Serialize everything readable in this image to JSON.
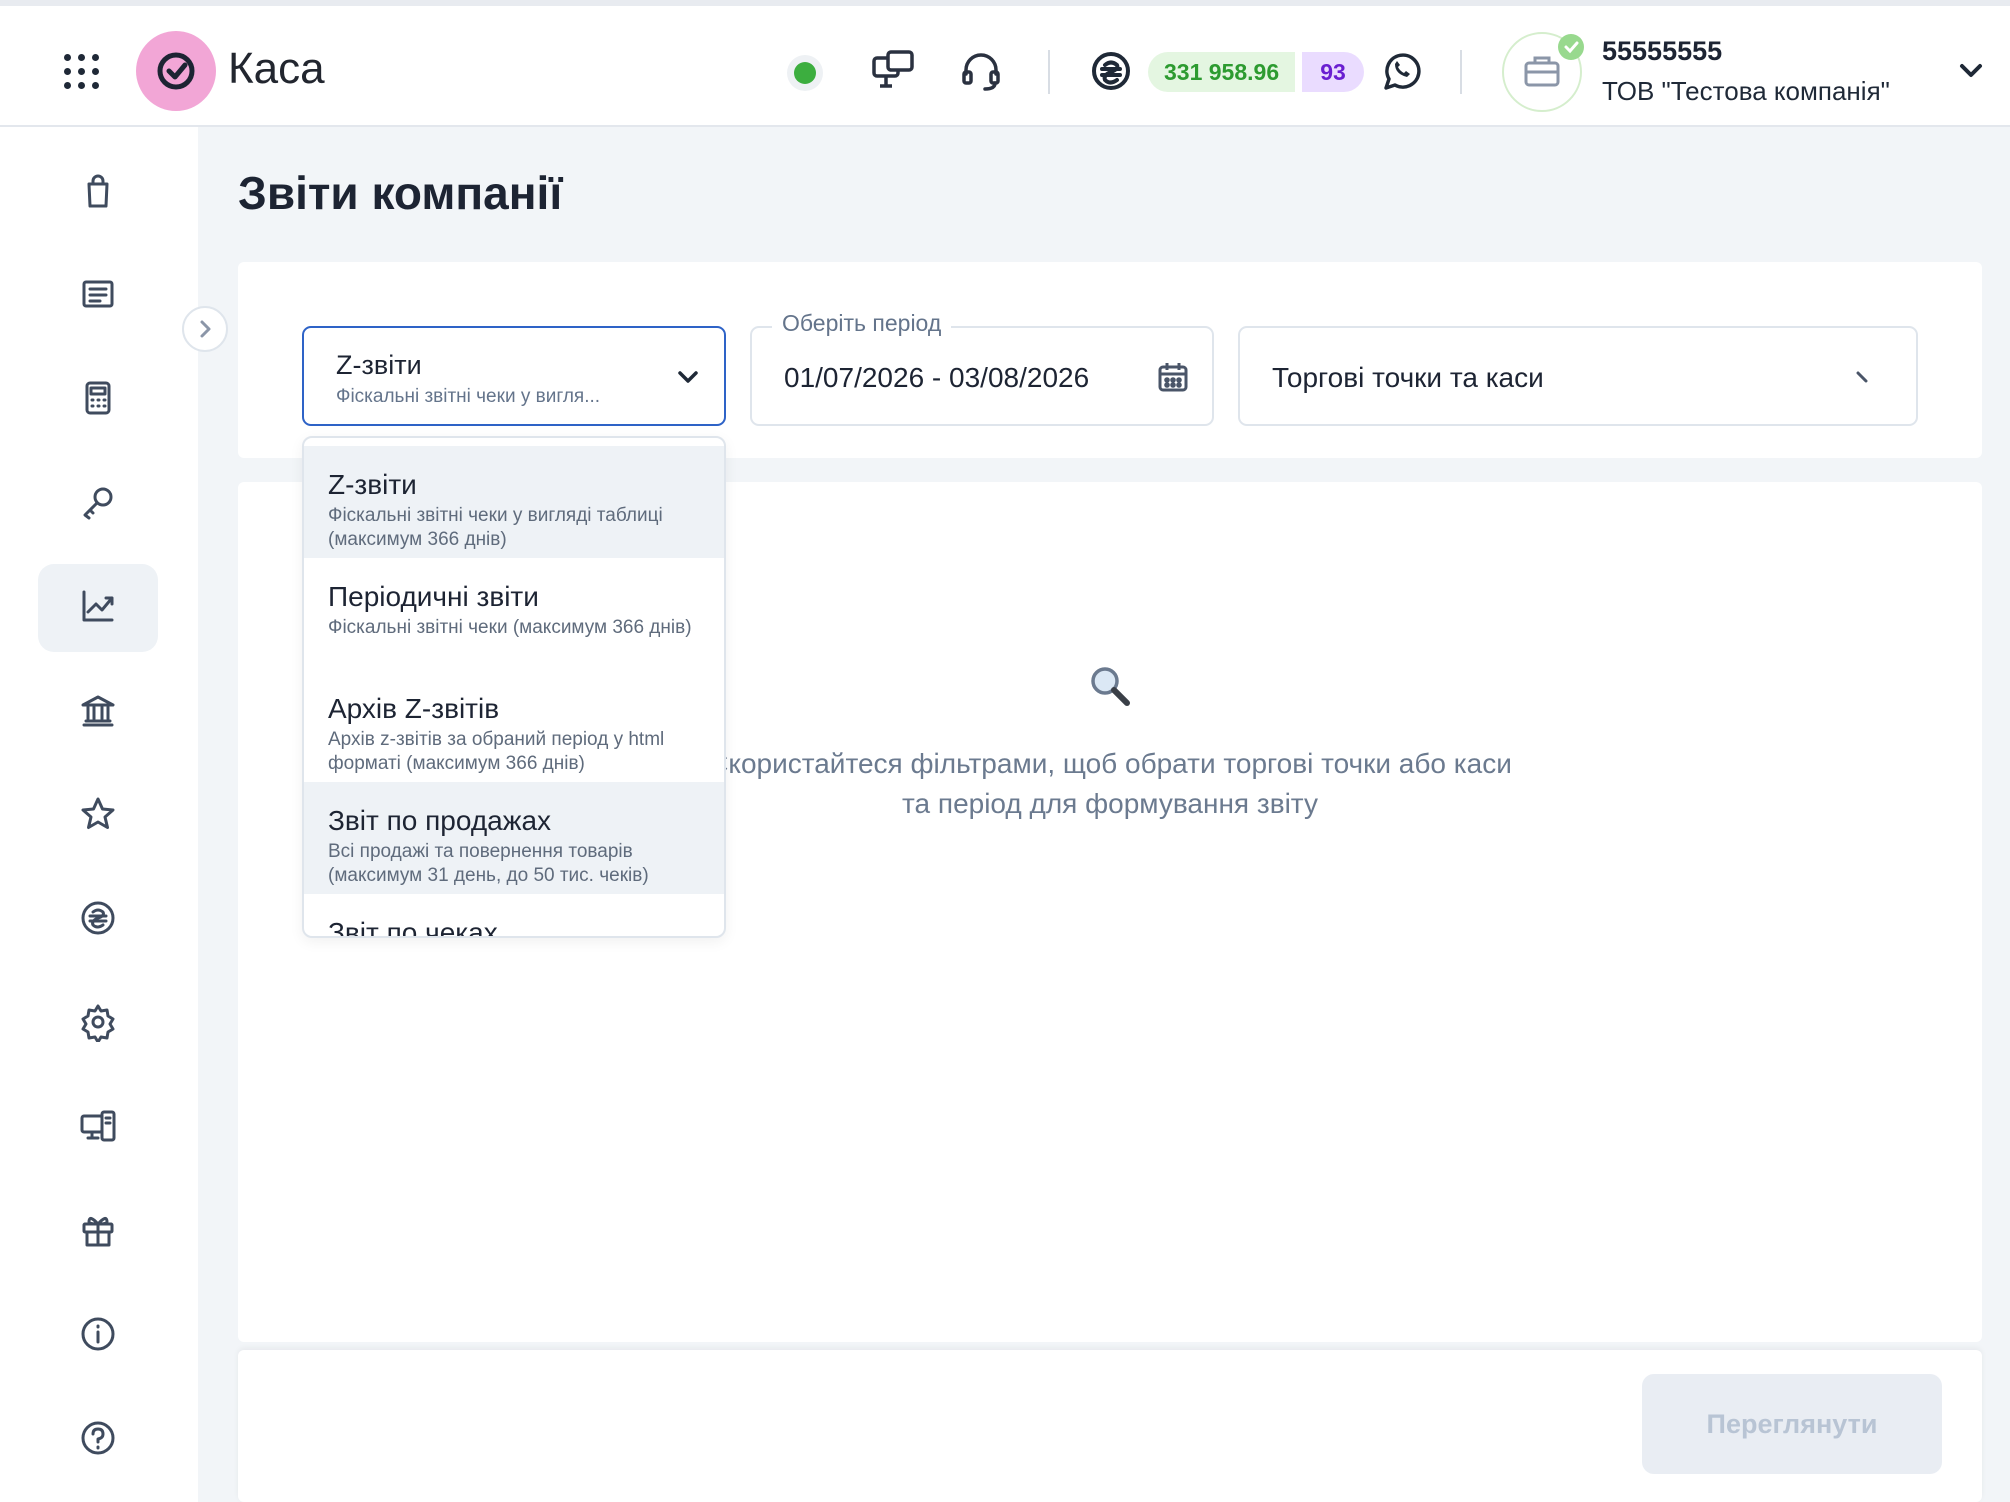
{
  "app": {
    "name": "Каса",
    "balance": "331 958.96",
    "count": "93",
    "company_id": "55555555",
    "company_name": "ТОВ \"Тестова компанія\""
  },
  "sidebar": {
    "items": [
      {
        "icon": "shopping-bag-icon"
      },
      {
        "icon": "receipt-icon"
      },
      {
        "icon": "calculator-icon"
      },
      {
        "icon": "key-icon"
      },
      {
        "icon": "chart-icon",
        "active": true
      },
      {
        "icon": "bank-icon"
      },
      {
        "icon": "star-icon"
      },
      {
        "icon": "hryvnia-icon"
      },
      {
        "icon": "settings-icon"
      },
      {
        "icon": "devices-icon"
      },
      {
        "icon": "gift-icon"
      },
      {
        "icon": "info-icon"
      },
      {
        "icon": "help-icon"
      }
    ]
  },
  "page": {
    "title": "Звіти компанії"
  },
  "filters": {
    "report": {
      "title": "Z-звіти",
      "subtitle": "Фіскальні звітні чеки у вигля..."
    },
    "period": {
      "label": "Оберіть період",
      "value": "01/07/2026 - 03/08/2026"
    },
    "points": {
      "value": "Торгові точки та каси"
    }
  },
  "dropdown": {
    "options": [
      {
        "title": "Z-звіти",
        "desc": "Фіскальні звітні чеки у вигляді таблиці (максимум 366 днів)"
      },
      {
        "title": "Періодичні звіти",
        "desc": "Фіскальні звітні чеки (максимум 366 днів)"
      },
      {
        "title": "Архів Z-звітів",
        "desc": "Архів z-звітів за обраний період у html форматі (максимум 366 днів)"
      },
      {
        "title": "Звіт по продажах",
        "desc": "Всі продажі та повернення товарів (максимум 31 день, до 50 тис. чеків)"
      },
      {
        "title": "Звіт по чеках",
        "desc": ""
      }
    ]
  },
  "empty": {
    "text": "Скористайтеся фільтрами, щоб обрати торгові точки або каси та період для формування звіту"
  },
  "footer": {
    "view_button": "Переглянути"
  },
  "colors": {
    "accent": "#2e63c7",
    "status_ok": "#3cae3f",
    "balance_bg": "#e4f6e1",
    "count_bg": "#eadcff",
    "logo": "#f2a6d6"
  }
}
